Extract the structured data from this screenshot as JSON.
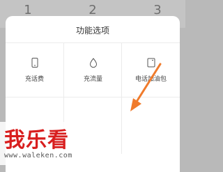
{
  "keypad": {
    "keys": [
      "1",
      "2",
      "3"
    ]
  },
  "sheet": {
    "title": "功能选项",
    "options": [
      {
        "label": "充话费",
        "icon": "phone-icon"
      },
      {
        "label": "充流量",
        "icon": "water-drop-icon"
      },
      {
        "label": "电话加油包",
        "icon": "document-icon"
      }
    ]
  },
  "watermark": {
    "text": "我乐看",
    "url": "www.waleken.com"
  },
  "colors": {
    "arrow": "#f07b2c",
    "watermark_text": "#d81e1e",
    "sheet_bg": "#ffffff",
    "backdrop": "#b9b9b9"
  }
}
